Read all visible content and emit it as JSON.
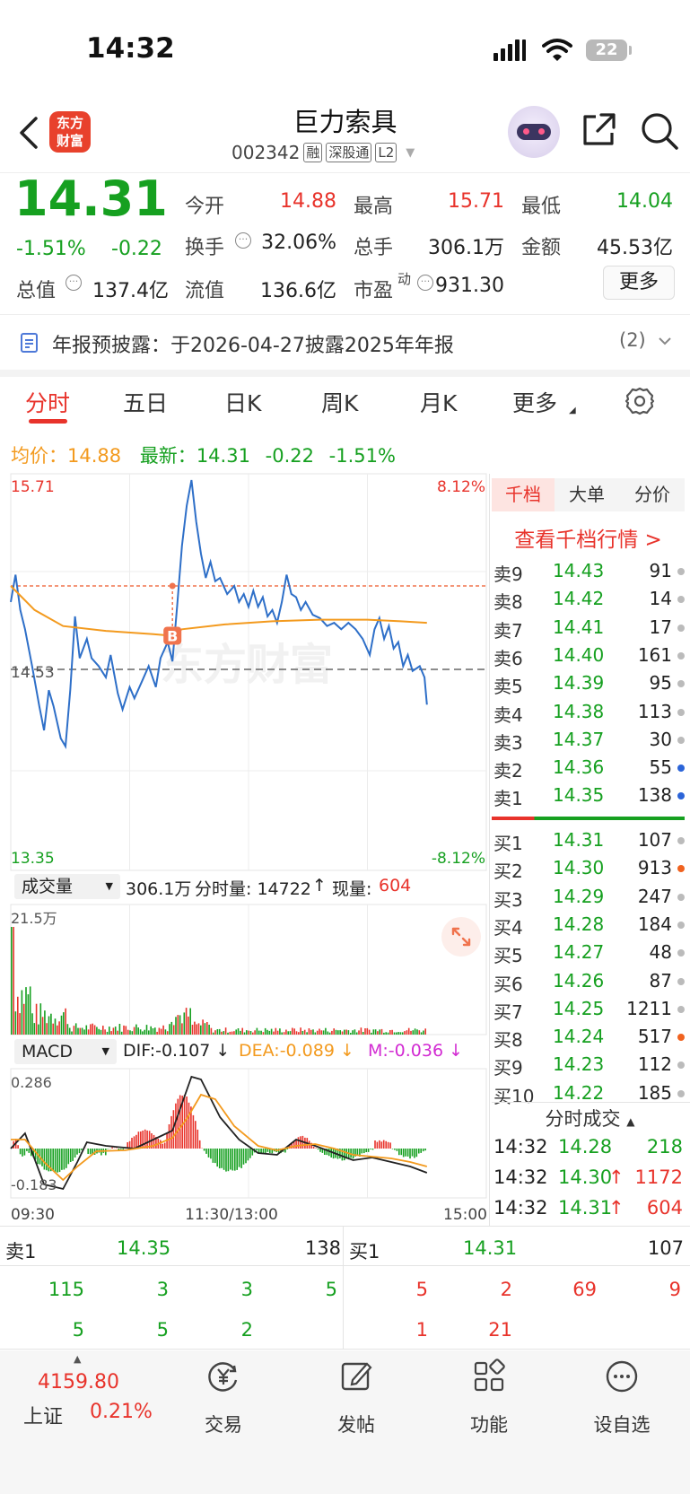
{
  "status_bar": {
    "time": "14:32",
    "battery": "22"
  },
  "header": {
    "logo_text_line1": "东方",
    "logo_text_line2": "财富",
    "stock_name": "巨力索具",
    "stock_code": "002342",
    "tags": [
      "融",
      "深股通",
      "L2"
    ]
  },
  "quote": {
    "price": "14.31",
    "change_pct": "-1.51%",
    "change": "-0.22",
    "open_label": "今开",
    "open": "14.88",
    "high_label": "最高",
    "high": "15.71",
    "low_label": "最低",
    "low": "14.04",
    "turnover_label": "换手",
    "turnover": "32.06%",
    "volume_label": "总手",
    "volume": "306.1万",
    "amount_label": "金额",
    "amount": "45.53亿",
    "mktcap_label": "总值",
    "mktcap": "137.4亿",
    "float_label": "流值",
    "float": "136.6亿",
    "pe_label": "市盈",
    "pe_sup": "动",
    "pe": "931.30",
    "more_button": "更多"
  },
  "notice": {
    "text": "年报预披露：于2026-04-27披露2025年年报",
    "count": "(2)"
  },
  "tabs": [
    "分时",
    "五日",
    "日K",
    "周K",
    "月K",
    "更多"
  ],
  "chart_info": {
    "avg_label": "均价：",
    "avg": "14.88",
    "latest_label": "最新：",
    "latest": "14.31",
    "latest_change": "-0.22",
    "latest_pct": "-1.51%"
  },
  "chart_labels": {
    "top_price": "15.71",
    "top_pct": "8.12%",
    "mid_price": "14.53",
    "bottom_price": "13.35",
    "bottom_pct": "-8.12%",
    "marker": "B"
  },
  "volume_bar": {
    "selector": "成交量",
    "total": "306.1万",
    "tick_label": "分时量: 14722",
    "now_label": "现量:",
    "now": "604",
    "max": "21.5万"
  },
  "macd_bar": {
    "selector": "MACD",
    "dif": "DIF:-0.107",
    "dea": "DEA:-0.089",
    "m": "M:-0.036",
    "top": "0.286",
    "bottom": "-0.183"
  },
  "time_axis": {
    "start": "09:30",
    "mid": "11:30/13:00",
    "end": "15:00"
  },
  "right_panel": {
    "tabs": [
      "千档",
      "大单",
      "分价"
    ],
    "link": "查看千档行情 >",
    "sells": [
      {
        "label": "卖9",
        "price": "14.43",
        "vol": "91",
        "dot": "#bbbbbb"
      },
      {
        "label": "卖8",
        "price": "14.42",
        "vol": "14",
        "dot": "#bbbbbb"
      },
      {
        "label": "卖7",
        "price": "14.41",
        "vol": "17",
        "dot": "#bbbbbb"
      },
      {
        "label": "卖6",
        "price": "14.40",
        "vol": "161",
        "dot": "#bbbbbb"
      },
      {
        "label": "卖5",
        "price": "14.39",
        "vol": "95",
        "dot": "#bbbbbb"
      },
      {
        "label": "卖4",
        "price": "14.38",
        "vol": "113",
        "dot": "#bbbbbb"
      },
      {
        "label": "卖3",
        "price": "14.37",
        "vol": "30",
        "dot": "#bbbbbb"
      },
      {
        "label": "卖2",
        "price": "14.36",
        "vol": "55",
        "dot": "#2b64d8"
      },
      {
        "label": "卖1",
        "price": "14.35",
        "vol": "138",
        "dot": "#2b64d8"
      }
    ],
    "buys": [
      {
        "label": "买1",
        "price": "14.31",
        "vol": "107",
        "dot": "#bbbbbb"
      },
      {
        "label": "买2",
        "price": "14.30",
        "vol": "913",
        "dot": "#f0621f"
      },
      {
        "label": "买3",
        "price": "14.29",
        "vol": "247",
        "dot": "#bbbbbb"
      },
      {
        "label": "买4",
        "price": "14.28",
        "vol": "184",
        "dot": "#bbbbbb"
      },
      {
        "label": "买5",
        "price": "14.27",
        "vol": "48",
        "dot": "#bbbbbb"
      },
      {
        "label": "买6",
        "price": "14.26",
        "vol": "87",
        "dot": "#bbbbbb"
      },
      {
        "label": "买7",
        "price": "14.25",
        "vol": "1211",
        "dot": "#bbbbbb"
      },
      {
        "label": "买8",
        "price": "14.24",
        "vol": "517",
        "dot": "#f0621f"
      },
      {
        "label": "买9",
        "price": "14.23",
        "vol": "112",
        "dot": "#bbbbbb"
      },
      {
        "label": "买10",
        "price": "14.22",
        "vol": "185",
        "dot": "#bbbbbb"
      }
    ],
    "trades_title": "分时成交",
    "trades": [
      {
        "time": "14:32",
        "price": "14.28",
        "arrow": "",
        "vol": "218"
      },
      {
        "time": "14:32",
        "price": "14.30",
        "arrow": "↑",
        "vol": "1172"
      },
      {
        "time": "14:32",
        "price": "14.31",
        "arrow": "↑",
        "vol": "604"
      }
    ]
  },
  "summary": {
    "sell_label": "卖1",
    "sell_price": "14.35",
    "sell_vol": "138",
    "buy_label": "买1",
    "buy_price": "14.31",
    "buy_vol": "107",
    "sell_queue_row1": [
      "115",
      "3",
      "3",
      "5"
    ],
    "sell_queue_row2": [
      "5",
      "5",
      "2"
    ],
    "buy_queue_row1": [
      "5",
      "2",
      "69",
      "9"
    ],
    "buy_queue_row2": [
      "1",
      "21"
    ]
  },
  "bottom_nav": {
    "index_value": "4159.80",
    "index_name": "上证",
    "index_pct": "0.21%",
    "items": [
      "交易",
      "发帖",
      "功能",
      "设自选"
    ]
  },
  "colors": {
    "up": "#e8332b",
    "down": "#16a020",
    "price_line": "#2e6fc8",
    "avg_line": "#f39a1e"
  }
}
